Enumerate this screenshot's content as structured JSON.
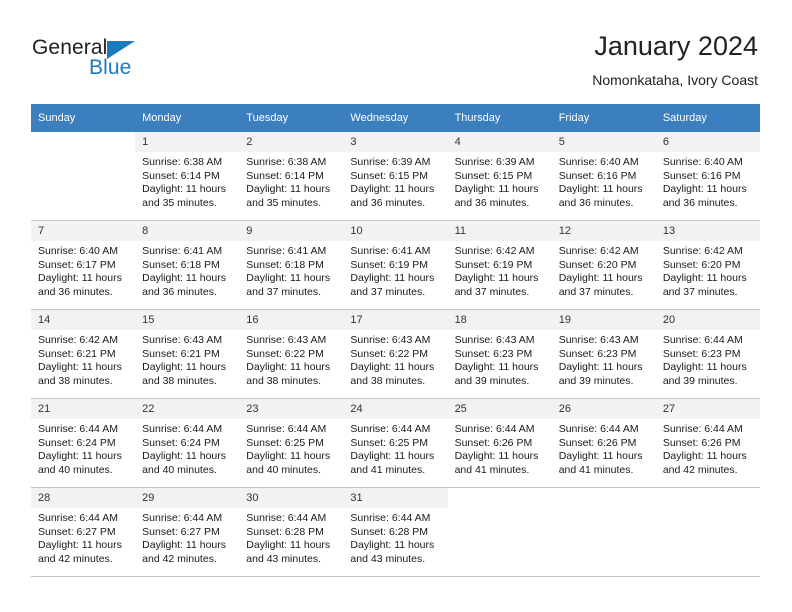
{
  "brand": {
    "name_part1": "General",
    "name_part2": "Blue",
    "accent_color": "#1c79c0"
  },
  "header": {
    "title": "January 2024",
    "subtitle": "Nomonkataha, Ivory Coast"
  },
  "calendar": {
    "header_bg": "#3c7fbf",
    "daynum_bg": "#f2f2f2",
    "weekdays": [
      "Sunday",
      "Monday",
      "Tuesday",
      "Wednesday",
      "Thursday",
      "Friday",
      "Saturday"
    ],
    "weeks": [
      [
        {
          "day": "",
          "lines": []
        },
        {
          "day": "1",
          "lines": [
            "Sunrise: 6:38 AM",
            "Sunset: 6:14 PM",
            "Daylight: 11 hours",
            "and 35 minutes."
          ]
        },
        {
          "day": "2",
          "lines": [
            "Sunrise: 6:38 AM",
            "Sunset: 6:14 PM",
            "Daylight: 11 hours",
            "and 35 minutes."
          ]
        },
        {
          "day": "3",
          "lines": [
            "Sunrise: 6:39 AM",
            "Sunset: 6:15 PM",
            "Daylight: 11 hours",
            "and 36 minutes."
          ]
        },
        {
          "day": "4",
          "lines": [
            "Sunrise: 6:39 AM",
            "Sunset: 6:15 PM",
            "Daylight: 11 hours",
            "and 36 minutes."
          ]
        },
        {
          "day": "5",
          "lines": [
            "Sunrise: 6:40 AM",
            "Sunset: 6:16 PM",
            "Daylight: 11 hours",
            "and 36 minutes."
          ]
        },
        {
          "day": "6",
          "lines": [
            "Sunrise: 6:40 AM",
            "Sunset: 6:16 PM",
            "Daylight: 11 hours",
            "and 36 minutes."
          ]
        }
      ],
      [
        {
          "day": "7",
          "lines": [
            "Sunrise: 6:40 AM",
            "Sunset: 6:17 PM",
            "Daylight: 11 hours",
            "and 36 minutes."
          ]
        },
        {
          "day": "8",
          "lines": [
            "Sunrise: 6:41 AM",
            "Sunset: 6:18 PM",
            "Daylight: 11 hours",
            "and 36 minutes."
          ]
        },
        {
          "day": "9",
          "lines": [
            "Sunrise: 6:41 AM",
            "Sunset: 6:18 PM",
            "Daylight: 11 hours",
            "and 37 minutes."
          ]
        },
        {
          "day": "10",
          "lines": [
            "Sunrise: 6:41 AM",
            "Sunset: 6:19 PM",
            "Daylight: 11 hours",
            "and 37 minutes."
          ]
        },
        {
          "day": "11",
          "lines": [
            "Sunrise: 6:42 AM",
            "Sunset: 6:19 PM",
            "Daylight: 11 hours",
            "and 37 minutes."
          ]
        },
        {
          "day": "12",
          "lines": [
            "Sunrise: 6:42 AM",
            "Sunset: 6:20 PM",
            "Daylight: 11 hours",
            "and 37 minutes."
          ]
        },
        {
          "day": "13",
          "lines": [
            "Sunrise: 6:42 AM",
            "Sunset: 6:20 PM",
            "Daylight: 11 hours",
            "and 37 minutes."
          ]
        }
      ],
      [
        {
          "day": "14",
          "lines": [
            "Sunrise: 6:42 AM",
            "Sunset: 6:21 PM",
            "Daylight: 11 hours",
            "and 38 minutes."
          ]
        },
        {
          "day": "15",
          "lines": [
            "Sunrise: 6:43 AM",
            "Sunset: 6:21 PM",
            "Daylight: 11 hours",
            "and 38 minutes."
          ]
        },
        {
          "day": "16",
          "lines": [
            "Sunrise: 6:43 AM",
            "Sunset: 6:22 PM",
            "Daylight: 11 hours",
            "and 38 minutes."
          ]
        },
        {
          "day": "17",
          "lines": [
            "Sunrise: 6:43 AM",
            "Sunset: 6:22 PM",
            "Daylight: 11 hours",
            "and 38 minutes."
          ]
        },
        {
          "day": "18",
          "lines": [
            "Sunrise: 6:43 AM",
            "Sunset: 6:23 PM",
            "Daylight: 11 hours",
            "and 39 minutes."
          ]
        },
        {
          "day": "19",
          "lines": [
            "Sunrise: 6:43 AM",
            "Sunset: 6:23 PM",
            "Daylight: 11 hours",
            "and 39 minutes."
          ]
        },
        {
          "day": "20",
          "lines": [
            "Sunrise: 6:44 AM",
            "Sunset: 6:23 PM",
            "Daylight: 11 hours",
            "and 39 minutes."
          ]
        }
      ],
      [
        {
          "day": "21",
          "lines": [
            "Sunrise: 6:44 AM",
            "Sunset: 6:24 PM",
            "Daylight: 11 hours",
            "and 40 minutes."
          ]
        },
        {
          "day": "22",
          "lines": [
            "Sunrise: 6:44 AM",
            "Sunset: 6:24 PM",
            "Daylight: 11 hours",
            "and 40 minutes."
          ]
        },
        {
          "day": "23",
          "lines": [
            "Sunrise: 6:44 AM",
            "Sunset: 6:25 PM",
            "Daylight: 11 hours",
            "and 40 minutes."
          ]
        },
        {
          "day": "24",
          "lines": [
            "Sunrise: 6:44 AM",
            "Sunset: 6:25 PM",
            "Daylight: 11 hours",
            "and 41 minutes."
          ]
        },
        {
          "day": "25",
          "lines": [
            "Sunrise: 6:44 AM",
            "Sunset: 6:26 PM",
            "Daylight: 11 hours",
            "and 41 minutes."
          ]
        },
        {
          "day": "26",
          "lines": [
            "Sunrise: 6:44 AM",
            "Sunset: 6:26 PM",
            "Daylight: 11 hours",
            "and 41 minutes."
          ]
        },
        {
          "day": "27",
          "lines": [
            "Sunrise: 6:44 AM",
            "Sunset: 6:26 PM",
            "Daylight: 11 hours",
            "and 42 minutes."
          ]
        }
      ],
      [
        {
          "day": "28",
          "lines": [
            "Sunrise: 6:44 AM",
            "Sunset: 6:27 PM",
            "Daylight: 11 hours",
            "and 42 minutes."
          ]
        },
        {
          "day": "29",
          "lines": [
            "Sunrise: 6:44 AM",
            "Sunset: 6:27 PM",
            "Daylight: 11 hours",
            "and 42 minutes."
          ]
        },
        {
          "day": "30",
          "lines": [
            "Sunrise: 6:44 AM",
            "Sunset: 6:28 PM",
            "Daylight: 11 hours",
            "and 43 minutes."
          ]
        },
        {
          "day": "31",
          "lines": [
            "Sunrise: 6:44 AM",
            "Sunset: 6:28 PM",
            "Daylight: 11 hours",
            "and 43 minutes."
          ]
        },
        {
          "day": "",
          "lines": []
        },
        {
          "day": "",
          "lines": []
        },
        {
          "day": "",
          "lines": []
        }
      ]
    ]
  }
}
